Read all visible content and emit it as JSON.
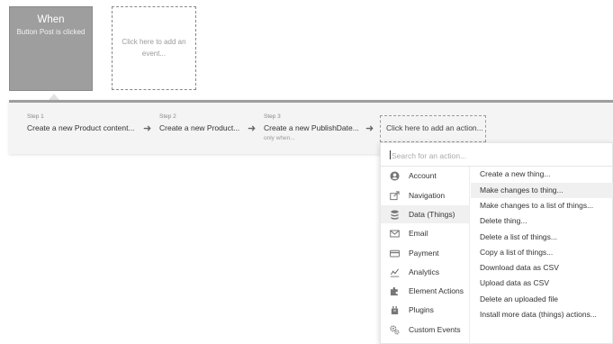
{
  "event": {
    "title": "When",
    "subtitle": "Button Post is clicked",
    "add_event_label": "Click here to add an event..."
  },
  "steps": [
    {
      "number": "Step 1",
      "title": "Create a new Product content..."
    },
    {
      "number": "Step 2",
      "title": "Create a new Product..."
    },
    {
      "number": "Step 3",
      "title": "Create a new PublishDate...",
      "condition": "only when..."
    }
  ],
  "add_action_label": "Click here to add an action...",
  "action_menu": {
    "search_placeholder": "Search for an action...",
    "categories": [
      {
        "label": "Account",
        "icon": "account-icon"
      },
      {
        "label": "Navigation",
        "icon": "navigation-icon"
      },
      {
        "label": "Data (Things)",
        "icon": "database-icon",
        "selected": true
      },
      {
        "label": "Email",
        "icon": "envelope-icon"
      },
      {
        "label": "Payment",
        "icon": "credit-card-icon"
      },
      {
        "label": "Analytics",
        "icon": "analytics-icon"
      },
      {
        "label": "Element Actions",
        "icon": "puzzle-icon"
      },
      {
        "label": "Plugins",
        "icon": "plugin-icon"
      },
      {
        "label": "Custom Events",
        "icon": "gears-icon"
      }
    ],
    "actions": [
      "Create a new thing...",
      "Make changes to thing...",
      "Make changes to a list of things...",
      "Delete thing...",
      "Delete a list of things...",
      "Copy a list of things...",
      "Download data as CSV",
      "Upload data as CSV",
      "Delete an uploaded file",
      "Install more data (things) actions..."
    ],
    "hovered_action": "Make changes to thing..."
  }
}
